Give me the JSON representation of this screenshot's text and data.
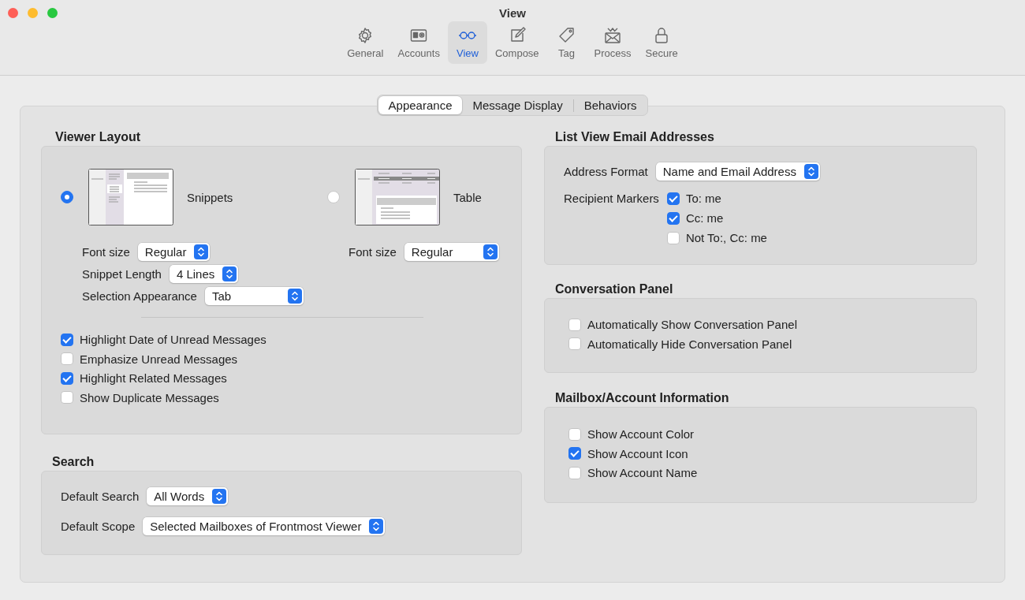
{
  "window": {
    "title": "View"
  },
  "toolbar": [
    {
      "label": "General",
      "selected": false
    },
    {
      "label": "Accounts",
      "selected": false
    },
    {
      "label": "View",
      "selected": true
    },
    {
      "label": "Compose",
      "selected": false
    },
    {
      "label": "Tag",
      "selected": false
    },
    {
      "label": "Process",
      "selected": false
    },
    {
      "label": "Secure",
      "selected": false
    }
  ],
  "segments": [
    {
      "label": "Appearance",
      "selected": true
    },
    {
      "label": "Message Display",
      "selected": false
    },
    {
      "label": "Behaviors",
      "selected": false
    }
  ],
  "viewer_layout": {
    "title": "Viewer Layout",
    "layouts": [
      {
        "kind": "snippets",
        "label": "Snippets",
        "selected": true,
        "settings": [
          {
            "label": "Font size",
            "value": "Regular"
          },
          {
            "label": "Snippet Length",
            "value": "4 Lines"
          },
          {
            "label": "Selection Appearance",
            "value": "Tab"
          }
        ]
      },
      {
        "kind": "table",
        "label": "Table",
        "selected": false,
        "settings": [
          {
            "label": "Font size",
            "value": "Regular"
          }
        ]
      }
    ],
    "options": [
      {
        "label": "Highlight Date of Unread Messages",
        "checked": true
      },
      {
        "label": "Emphasize Unread Messages",
        "checked": false
      },
      {
        "label": "Highlight Related Messages",
        "checked": true
      },
      {
        "label": "Show Duplicate Messages",
        "checked": false
      }
    ]
  },
  "search": {
    "title": "Search",
    "fields": [
      {
        "label": "Default Search",
        "value": "All Words"
      },
      {
        "label": "Default Scope",
        "value": "Selected Mailboxes of Frontmost Viewer"
      }
    ]
  },
  "list_view_email_addresses": {
    "title": "List View Email Addresses",
    "address_format": {
      "label": "Address Format",
      "value": "Name and Email Address"
    },
    "recipient_markers": {
      "label": "Recipient Markers",
      "options": [
        {
          "label": "To: me",
          "checked": true
        },
        {
          "label": "Cc: me",
          "checked": true
        },
        {
          "label": "Not To:, Cc: me",
          "checked": false
        }
      ]
    }
  },
  "conversation_panel": {
    "title": "Conversation Panel",
    "options": [
      {
        "label": "Automatically Show Conversation Panel",
        "checked": false
      },
      {
        "label": "Automatically Hide Conversation Panel",
        "checked": false
      }
    ]
  },
  "mailbox_account_information": {
    "title": "Mailbox/Account Information",
    "options": [
      {
        "label": "Show Account Color",
        "checked": false
      },
      {
        "label": "Show Account Icon",
        "checked": true
      },
      {
        "label": "Show Account Name",
        "checked": false
      }
    ]
  }
}
